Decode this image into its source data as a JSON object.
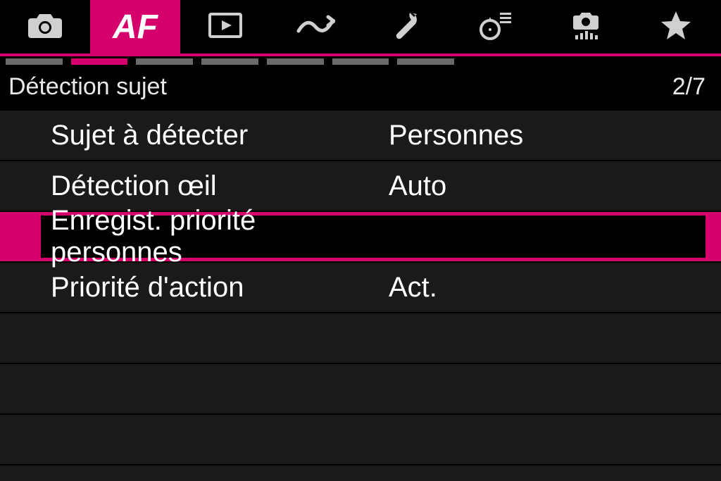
{
  "colors": {
    "accent": "#d6006c",
    "background": "#1a1a1a"
  },
  "tabs": {
    "active_index": 1,
    "af_label": "AF"
  },
  "segments": {
    "count": 7,
    "active_index": 1
  },
  "header": {
    "title": "Détection sujet",
    "page_indicator": "2/7"
  },
  "menu": {
    "items": [
      {
        "label": "Sujet à détecter",
        "value": "Personnes",
        "selected": false
      },
      {
        "label": "Détection œil",
        "value": "Auto",
        "selected": false
      },
      {
        "label": "Enregist. priorité personnes",
        "value": "",
        "selected": true
      },
      {
        "label": "Priorité d'action",
        "value": "Act.",
        "selected": false
      }
    ]
  }
}
